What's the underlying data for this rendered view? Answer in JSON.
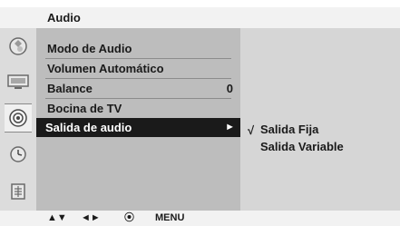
{
  "header": {
    "title": "Audio"
  },
  "icons": [
    {
      "name": "picture-icon"
    },
    {
      "name": "display-icon"
    },
    {
      "name": "audio-icon"
    },
    {
      "name": "time-icon"
    },
    {
      "name": "option-icon"
    }
  ],
  "menu": {
    "items": [
      {
        "label": "Modo de Audio",
        "value": ""
      },
      {
        "label": "Volumen Automático",
        "value": ""
      },
      {
        "label": "Balance",
        "value": "0"
      },
      {
        "label": "Bocina de TV",
        "value": ""
      },
      {
        "label": "Salida de audio",
        "value": "►"
      }
    ]
  },
  "submenu": {
    "check": "√",
    "items": [
      {
        "label": "Salida Fija",
        "selected": true
      },
      {
        "label": "Salida Variable",
        "selected": false
      }
    ]
  },
  "footer": {
    "updown": "▲▼",
    "leftright": "◄►",
    "ok": "⦿",
    "menu": "MENU"
  },
  "colors": {
    "highlight": "#1a1a1a",
    "menu_bg": "#bdbdbd",
    "submenu_bg": "#d6d6d6",
    "icon_col_bg": "#dcdcdc"
  }
}
